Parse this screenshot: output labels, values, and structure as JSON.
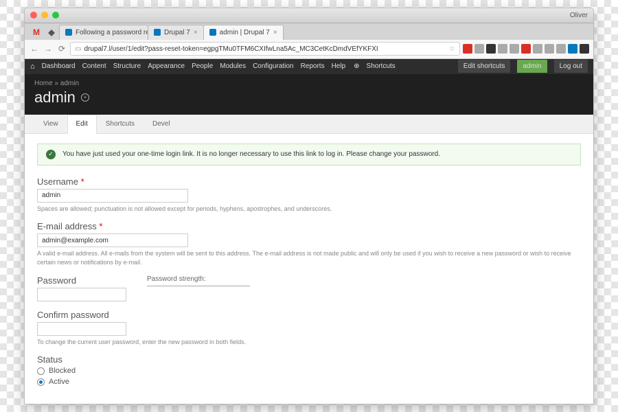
{
  "window": {
    "user": "Oliver"
  },
  "tabs": [
    {
      "label": "Following a password res"
    },
    {
      "label": "Drupal 7"
    },
    {
      "label": "admin | Drupal 7"
    }
  ],
  "address": "drupal7.l/user/1/edit?pass-reset-token=egpgTMu0TFM6CXIfwLna5Ac_MC3CetKcDmdVEfYKFXI",
  "admin_menu": {
    "items": [
      "Dashboard",
      "Content",
      "Structure",
      "Appearance",
      "People",
      "Modules",
      "Configuration",
      "Reports",
      "Help"
    ],
    "shortcuts": "Shortcuts",
    "right": {
      "edit": "Edit shortcuts",
      "admin": "admin",
      "logout": "Log out"
    }
  },
  "breadcrumb": "Home » admin",
  "page_title": "admin",
  "local_tabs": [
    "View",
    "Edit",
    "Shortcuts",
    "Devel"
  ],
  "message": "You have just used your one-time login link. It is no longer necessary to use this link to log in. Please change your password.",
  "form": {
    "username": {
      "label": "Username",
      "value": "admin",
      "desc": "Spaces are allowed; punctuation is not allowed except for periods, hyphens, apostrophes, and underscores."
    },
    "email": {
      "label": "E-mail address",
      "value": "admin@example.com",
      "desc": "A valid e-mail address. All e-mails from the system will be sent to this address. The e-mail address is not made public and will only be used if you wish to receive a new password or wish to receive certain news or notifications by e-mail."
    },
    "password": {
      "label": "Password",
      "strength_label": "Password strength:"
    },
    "confirm": {
      "label": "Confirm password",
      "desc": "To change the current user password, enter the new password in both fields."
    },
    "status": {
      "label": "Status",
      "blocked": "Blocked",
      "active": "Active"
    }
  }
}
